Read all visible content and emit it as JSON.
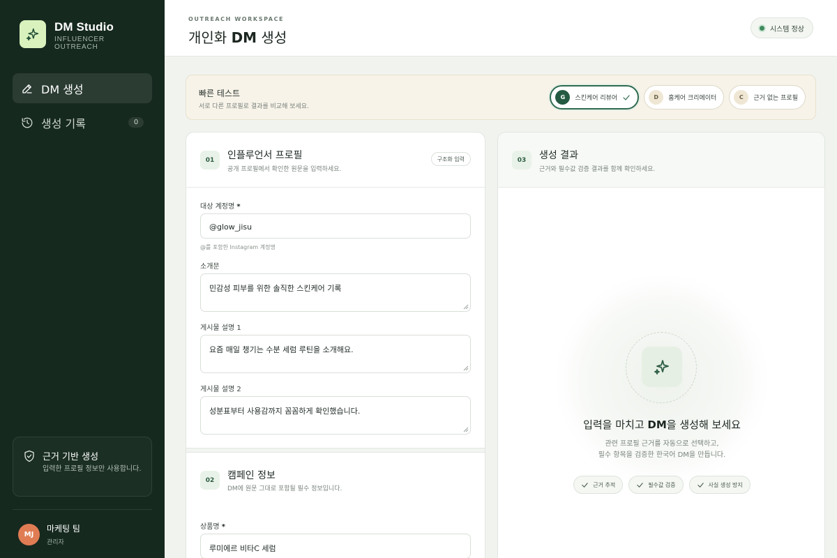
{
  "brand": {
    "name": "DM Studio",
    "subtitle": "INFLUENCER OUTREACH"
  },
  "nav": [
    {
      "label": "DM 생성",
      "icon": "pencil-icon",
      "active": true
    },
    {
      "label": "생성 기록",
      "icon": "history-icon",
      "badge": "0"
    }
  ],
  "info": {
    "title": "근거 기반 생성",
    "desc": "입력한 프로필 정보만 사용합니다."
  },
  "user": {
    "initials": "MJ",
    "name": "마케팅 팀",
    "role": "관리자"
  },
  "header": {
    "eyebrow": "OUTREACH WORKSPACE",
    "title_pre": "개인화 ",
    "title_bold": "DM",
    "title_post": " 생성",
    "status": "시스템 정상"
  },
  "quick": {
    "title": "빠른 테스트",
    "desc": "서로 다른 프로필로 결과를 비교해 보세요.",
    "presets": [
      {
        "chip": "G",
        "label": "스킨케어 리뷰어",
        "selected": true
      },
      {
        "chip": "D",
        "label": "홈케어 크리에이터",
        "selected": false
      },
      {
        "chip": "C",
        "label": "근거 없는 프로필",
        "selected": false
      }
    ]
  },
  "profile": {
    "num": "01",
    "title": "인플루언서 프로필",
    "desc": "공개 프로필에서 확인한 원문을 입력하세요.",
    "tag": "구조화 입력",
    "account_label": "대상 계정명",
    "account_value": "@glow_jisu",
    "account_hint": "@를 포함한 Instagram 계정명",
    "bio_label": "소개문",
    "bio_value": "민감성 피부를 위한 솔직한 스킨케어 기록",
    "post1_label": "게시물 설명 1",
    "post1_value": "요즘 매일 챙기는 수분 세럼 루틴을 소개해요.",
    "post2_label": "게시물 설명 2",
    "post2_value": "성분표부터 사용감까지 꼼꼼하게 확인했습니다."
  },
  "campaign": {
    "num": "02",
    "title": "캠페인 정보",
    "desc": "DM에 원문 그대로 포함될 필수 정보입니다.",
    "product_label": "상품명",
    "product_value": "루미에르 비타C 세럼"
  },
  "result": {
    "num": "03",
    "title": "생성 결과",
    "desc": "근거와 필수값 검증 결과를 함께 확인하세요.",
    "empty_title_pre": "입력을 마치고 ",
    "empty_title_bold": "DM",
    "empty_title_post": "을 생성해 보세요",
    "empty_desc_1": "관련 프로필 근거를 자동으로 선택하고,",
    "empty_desc_2": "필수 항목을 검증한 한국어 DM을 만듭니다.",
    "features": [
      "근거 추적",
      "필수값 검증",
      "사실 생성 방지"
    ]
  }
}
